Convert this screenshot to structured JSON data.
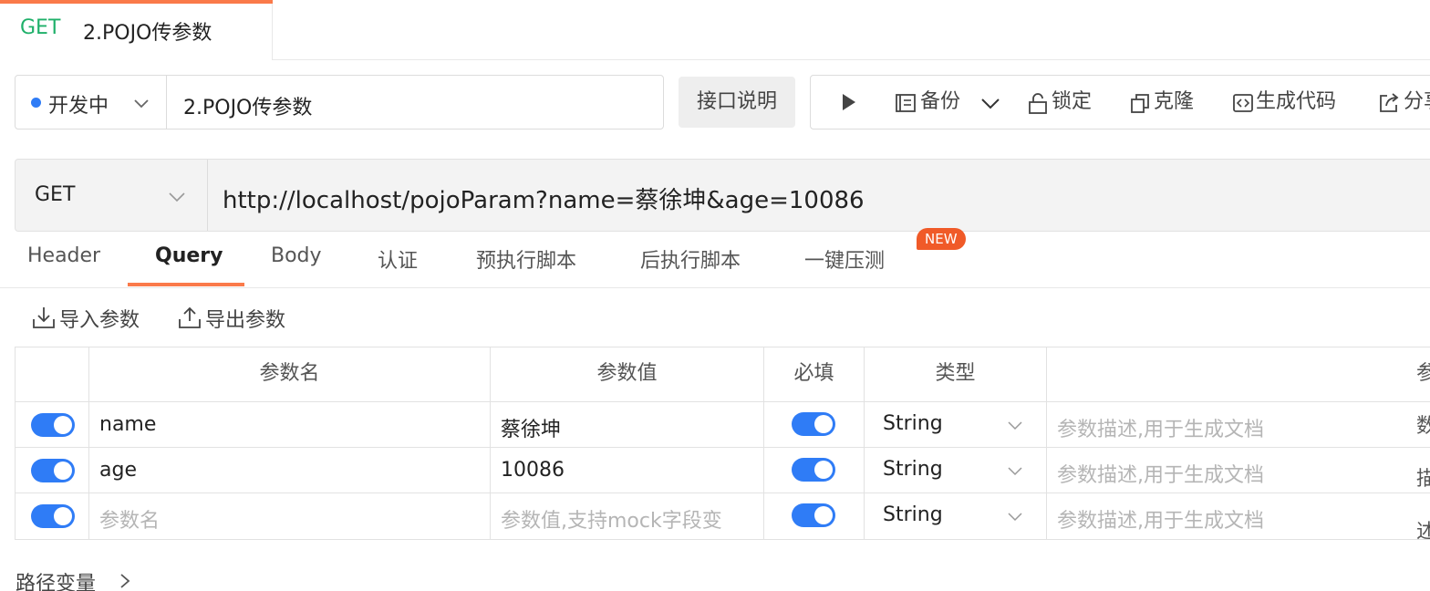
{
  "tab": {
    "method": "GET",
    "title": "2.POJO传参数"
  },
  "toolbar": {
    "status": "开发中",
    "name_value": "2.POJO传参数",
    "doc_button": "接口说明",
    "actions": {
      "backup": "备份",
      "lock": "锁定",
      "clone": "克隆",
      "generate_code": "生成代码",
      "share": "分享"
    }
  },
  "request": {
    "method": "GET",
    "url": "http://localhost/pojoParam?name=蔡徐坤&age=10086"
  },
  "subtabs": {
    "items": [
      {
        "label": "Header"
      },
      {
        "label": "Query"
      },
      {
        "label": "Body"
      },
      {
        "label": "认证"
      },
      {
        "label": "预执行脚本"
      },
      {
        "label": "后执行脚本"
      },
      {
        "label": "一键压测"
      }
    ],
    "active": "Query",
    "new_badge": "NEW"
  },
  "params": {
    "import_label": "导入参数",
    "export_label": "导出参数",
    "columns": [
      "参数名",
      "参数值",
      "必填",
      "类型",
      "参数描述"
    ],
    "rows": [
      {
        "enabled": true,
        "name": "name",
        "value": "蔡徐坤",
        "required": true,
        "type": "String",
        "desc_placeholder": "参数描述,用于生成文档"
      },
      {
        "enabled": true,
        "name": "age",
        "value": "10086",
        "required": true,
        "type": "String",
        "desc_placeholder": "参数描述,用于生成文档"
      }
    ],
    "new_row": {
      "enabled": true,
      "name_placeholder": "参数名",
      "value_placeholder": "参数值,支持mock字段变",
      "required": true,
      "type": "String",
      "desc_placeholder": "参数描述,用于生成文档"
    }
  },
  "path_vars": {
    "label": "路径变量"
  },
  "colors": {
    "accent": "#fa7a4a",
    "method_get": "#1fb06a",
    "toggle": "#2f7cf6",
    "badge": "#f05a28"
  }
}
